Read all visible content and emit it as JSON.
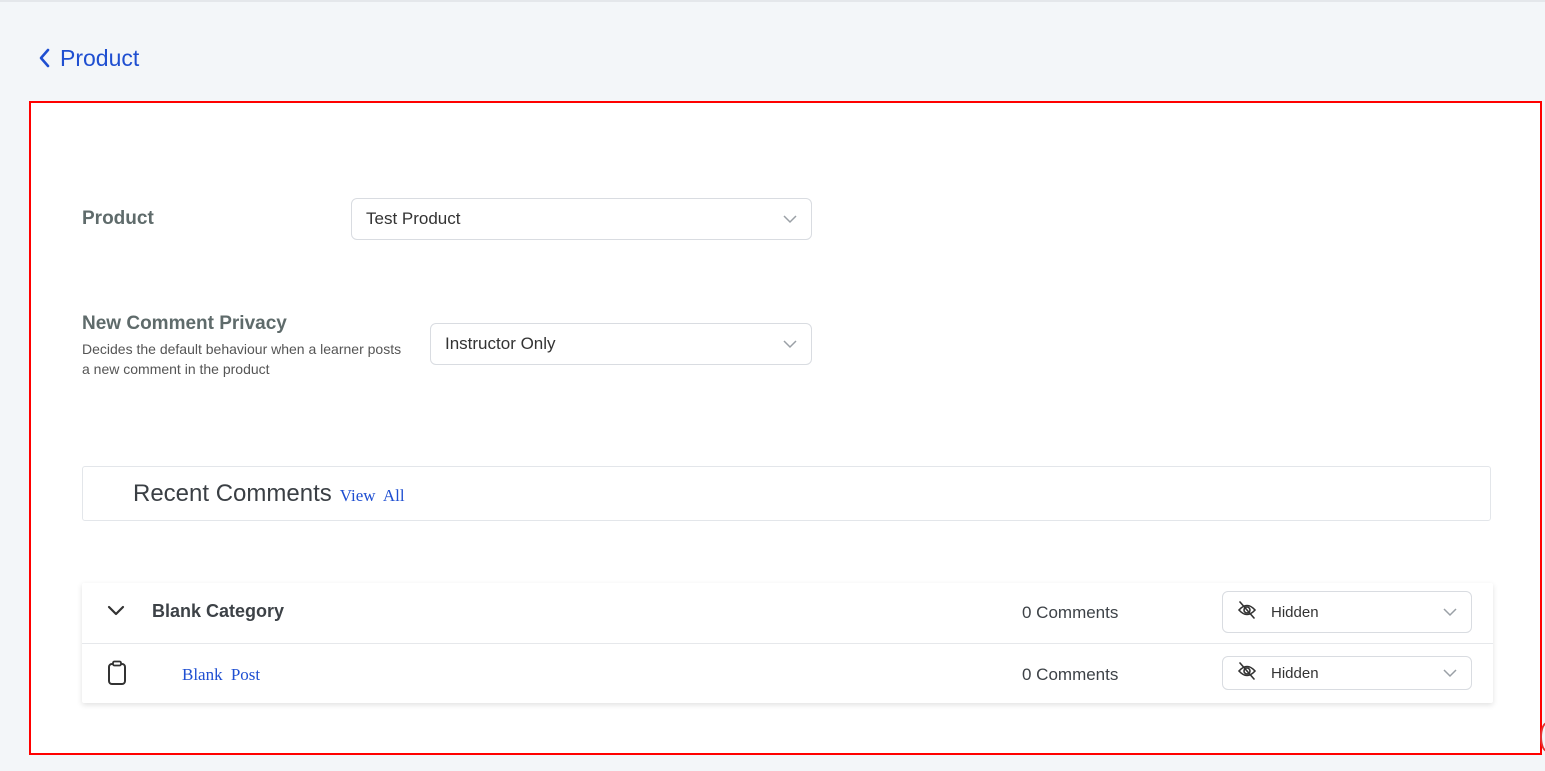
{
  "header": {
    "back_label": "Product"
  },
  "form": {
    "product": {
      "label": "Product",
      "value": "Test Product"
    },
    "privacy": {
      "label": "New Comment Privacy",
      "help": "Decides the default behaviour when a learner posts a new comment in the product",
      "value": "Instructor Only"
    }
  },
  "recent": {
    "title": "Recent Comments",
    "view_all": "View  All",
    "rows": [
      {
        "type": "category",
        "title": "Blank Category",
        "count": "0 Comments",
        "visibility": "Hidden",
        "icon": "chevron-down-icon"
      },
      {
        "type": "post",
        "title": "Blank  Post",
        "count": "0 Comments",
        "visibility": "Hidden",
        "icon": "clipboard-icon"
      }
    ]
  },
  "colors": {
    "accent": "#1f4fd1",
    "highlight_border": "#ff0000",
    "background": "#f3f6f9"
  },
  "icons": {
    "back": "chevron-left-icon",
    "visibility": "eye-off-icon",
    "dropdown": "chevron-down-icon"
  }
}
